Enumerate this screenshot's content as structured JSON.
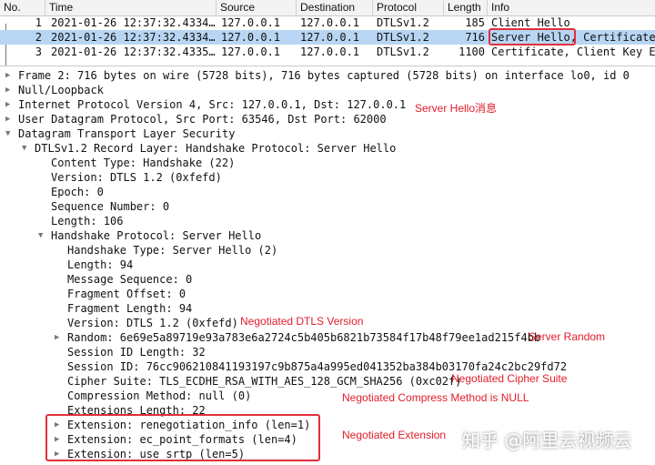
{
  "packet_list": {
    "columns": [
      "No.",
      "Time",
      "Source",
      "Destination",
      "Protocol",
      "Length",
      "Info"
    ],
    "rows": [
      {
        "no": "1",
        "time": "2021-01-26 12:37:32.4334…",
        "source": "127.0.0.1",
        "destination": "127.0.0.1",
        "protocol": "DTLSv1.2",
        "length": "185",
        "info": "Client Hello"
      },
      {
        "no": "2",
        "time": "2021-01-26 12:37:32.4334…",
        "source": "127.0.0.1",
        "destination": "127.0.0.1",
        "protocol": "DTLSv1.2",
        "length": "716",
        "info_highlight": "Server Hello,",
        "info_rest": " Certificate, Server Key Exchange"
      },
      {
        "no": "3",
        "time": "2021-01-26 12:37:32.4335…",
        "source": "127.0.0.1",
        "destination": "127.0.0.1",
        "protocol": "DTLSv1.2",
        "length": "1100",
        "info": "Certificate, Client Key Exchange"
      }
    ]
  },
  "tree": {
    "frame": "Frame 2: 716 bytes on wire (5728 bits), 716 bytes captured (5728 bits) on interface lo0, id 0",
    "null_loopback": "Null/Loopback",
    "ipv4": "Internet Protocol Version 4, Src: 127.0.0.1, Dst: 127.0.0.1",
    "udp": "User Datagram Protocol, Src Port: 63546, Dst Port: 62000",
    "dtls": "Datagram Transport Layer Security",
    "record_layer": "DTLSv1.2 Record Layer: Handshake Protocol: Server Hello",
    "content_type": "Content Type: Handshake (22)",
    "version": "Version: DTLS 1.2 (0xfefd)",
    "epoch": "Epoch: 0",
    "sequence_number": "Sequence Number: 0",
    "length": "Length: 106",
    "handshake_protocol": "Handshake Protocol: Server Hello",
    "handshake_type": "Handshake Type: Server Hello (2)",
    "hs_length": "Length: 94",
    "message_sequence": "Message Sequence: 0",
    "fragment_offset": "Fragment Offset: 0",
    "fragment_length": "Fragment Length: 94",
    "hs_version": "Version: DTLS 1.2 (0xfefd)",
    "random": "Random: 6e69e5a89719e93a783e6a2724c5b405b6821b73584f17b48f79ee1ad215f4bb",
    "session_id_length": "Session ID Length: 32",
    "session_id": "Session ID: 76cc906210841193197c9b875a4a995ed041352ba384b03170fa24c2bc29fd72",
    "cipher_suite": "Cipher Suite: TLS_ECDHE_RSA_WITH_AES_128_GCM_SHA256 (0xc02f)",
    "compression_method": "Compression Method: null (0)",
    "extensions_length": "Extensions Length: 22",
    "ext_renegotiation": "Extension: renegotiation_info (len=1)",
    "ext_ec_point": "Extension: ec_point_formats (len=4)",
    "ext_use_srtp": "Extension: use_srtp (len=5)"
  },
  "annotations": {
    "server_hello_msg": "Server Hello消息",
    "negotiated_dtls_version": "Negotiated DTLS Version",
    "server_random": "Server Random",
    "negotiated_cipher_suite": "Negotiated Cipher Suite",
    "negotiated_compress": "Negotiated Compress Method is NULL",
    "negotiated_extension": "Negotiated Extension"
  },
  "watermark": "知乎 @阿里云视频云",
  "colors": {
    "annotation": "#e11d2a",
    "selection": "#b8d6f3",
    "box": "#e1303a"
  }
}
